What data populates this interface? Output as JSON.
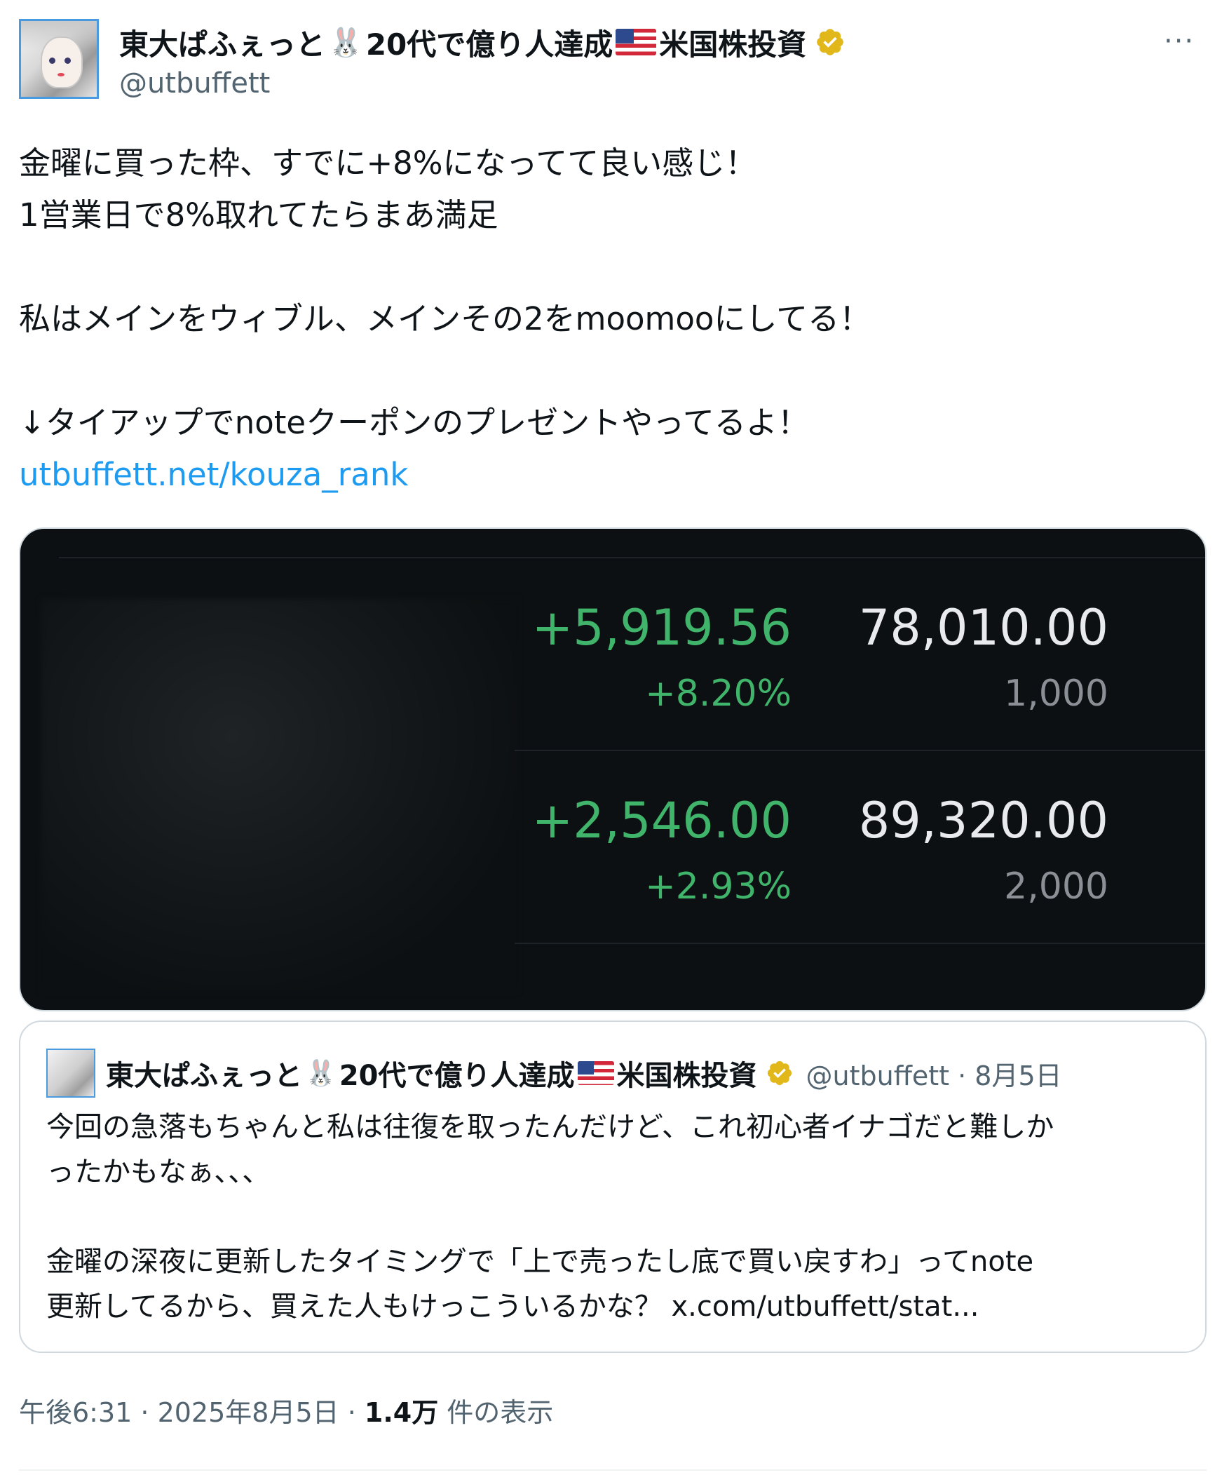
{
  "author": {
    "name_prefix": "東大ぱふぇっと",
    "name_mid": "20代で億り人達成",
    "name_suffix": "米国株投資",
    "rabbit_icon": "rabbit-emoji",
    "flag_icon": "us-flag",
    "handle": "@utbuffett"
  },
  "more_button": "···",
  "post": {
    "lines": [
      "金曜に買った枠、すでに+8%になってて良い感じ！",
      "1営業日で8%取れてたらまあ満足",
      "",
      "私はメインをウィブル、メインその2をmoomooにしてる！",
      "",
      "↓タイアップでnoteクーポンのプレゼントやってるよ！"
    ],
    "link": "utbuffett.net/kouza_rank"
  },
  "media": {
    "rows": [
      {
        "change": "+5,919.56",
        "change_pct": "+8.20%",
        "value": "78,010.00",
        "qty": "1,000"
      },
      {
        "change": "+2,546.00",
        "change_pct": "+2.93%",
        "value": "89,320.00",
        "qty": "2,000"
      }
    ],
    "colors": {
      "gain": "#3fb46a",
      "background": "#0d1012"
    }
  },
  "quote": {
    "name_prefix": "東大ぱふぇっと",
    "name_mid": "20代で億り人達成",
    "name_suffix": "米国株投資",
    "meta": "@utbuffett · 8月5日",
    "lines": [
      "今回の急落もちゃんと私は往復を取ったんだけど、これ初心者イナゴだと難しか",
      "ったかもなぁ、、、",
      "",
      "金曜の深夜に更新したタイミングで「上で売ったし底で買い戻すわ」ってnote",
      "更新してるから、買えた人もけっこういるかな？ x.com/utbuffett/stat..."
    ]
  },
  "footer": {
    "time": "午後6:31 · 2025年8月5日 · ",
    "views": "1.4万",
    "views_label": " 件の表示"
  }
}
